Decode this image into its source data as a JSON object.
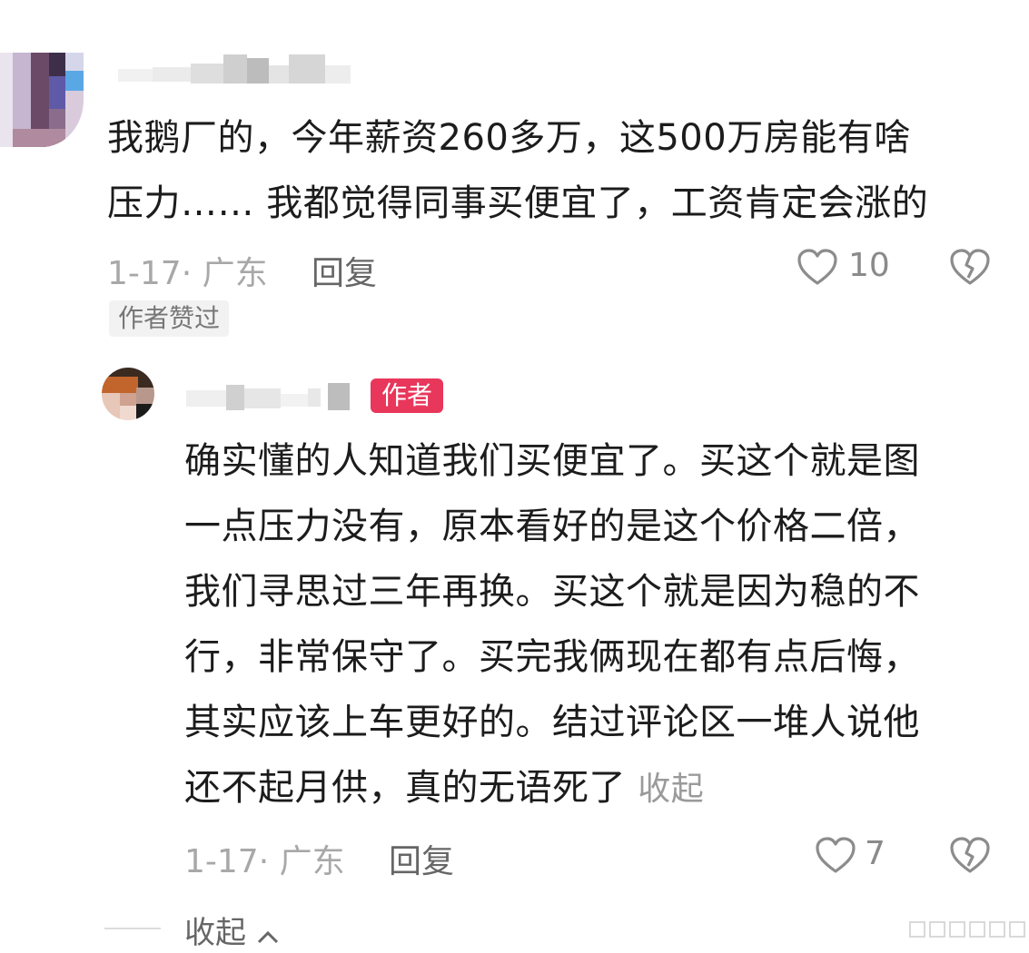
{
  "comment": {
    "text_line1": "我鹅厂的，今年薪资260多万，这500万房能有啥",
    "text_line2": "压力…… 我都觉得同事买便宜了，工资肯定会涨的",
    "meta": "1-17· 广东",
    "reply_label": "回复",
    "like_count": "10",
    "author_liked_badge": "作者赞过"
  },
  "reply": {
    "author_badge": "作者",
    "lines": [
      "确实懂的人知道我们买便宜了。买这个就是图",
      "一点压力没有，原本看好的是这个价格二倍，",
      "我们寻思过三年再换。买这个就是因为稳的不",
      "行，非常保守了。买完我俩现在都有点后悔，",
      "其实应该上车更好的。结过评论区一堆人说他",
      "还不起月供，真的无语死了"
    ],
    "collapse_inline": "收起",
    "meta": "1-17· 广东",
    "reply_label": "回复",
    "like_count": "7"
  },
  "footer": {
    "collapse_label": "收起"
  },
  "colors": {
    "author_badge": "#e8375b",
    "meta_text": "#a8a8a8",
    "icon_stroke": "#8c8c8c"
  }
}
